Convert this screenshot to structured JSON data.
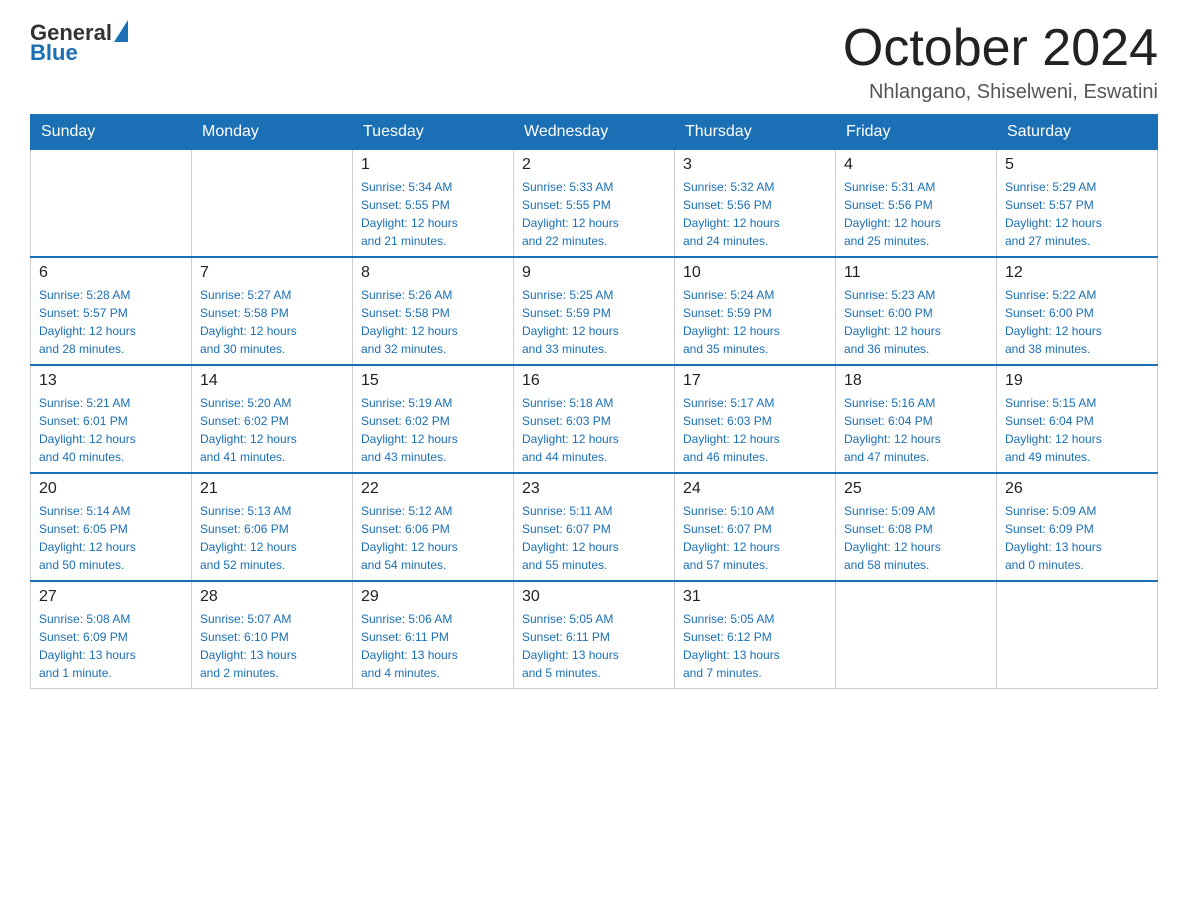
{
  "header": {
    "logo": {
      "text_general": "General",
      "text_blue": "Blue"
    },
    "title": "October 2024",
    "subtitle": "Nhlangano, Shiselweni, Eswatini"
  },
  "days_of_week": [
    "Sunday",
    "Monday",
    "Tuesday",
    "Wednesday",
    "Thursday",
    "Friday",
    "Saturday"
  ],
  "weeks": [
    [
      {
        "day": "",
        "info": ""
      },
      {
        "day": "",
        "info": ""
      },
      {
        "day": "1",
        "info": "Sunrise: 5:34 AM\nSunset: 5:55 PM\nDaylight: 12 hours\nand 21 minutes."
      },
      {
        "day": "2",
        "info": "Sunrise: 5:33 AM\nSunset: 5:55 PM\nDaylight: 12 hours\nand 22 minutes."
      },
      {
        "day": "3",
        "info": "Sunrise: 5:32 AM\nSunset: 5:56 PM\nDaylight: 12 hours\nand 24 minutes."
      },
      {
        "day": "4",
        "info": "Sunrise: 5:31 AM\nSunset: 5:56 PM\nDaylight: 12 hours\nand 25 minutes."
      },
      {
        "day": "5",
        "info": "Sunrise: 5:29 AM\nSunset: 5:57 PM\nDaylight: 12 hours\nand 27 minutes."
      }
    ],
    [
      {
        "day": "6",
        "info": "Sunrise: 5:28 AM\nSunset: 5:57 PM\nDaylight: 12 hours\nand 28 minutes."
      },
      {
        "day": "7",
        "info": "Sunrise: 5:27 AM\nSunset: 5:58 PM\nDaylight: 12 hours\nand 30 minutes."
      },
      {
        "day": "8",
        "info": "Sunrise: 5:26 AM\nSunset: 5:58 PM\nDaylight: 12 hours\nand 32 minutes."
      },
      {
        "day": "9",
        "info": "Sunrise: 5:25 AM\nSunset: 5:59 PM\nDaylight: 12 hours\nand 33 minutes."
      },
      {
        "day": "10",
        "info": "Sunrise: 5:24 AM\nSunset: 5:59 PM\nDaylight: 12 hours\nand 35 minutes."
      },
      {
        "day": "11",
        "info": "Sunrise: 5:23 AM\nSunset: 6:00 PM\nDaylight: 12 hours\nand 36 minutes."
      },
      {
        "day": "12",
        "info": "Sunrise: 5:22 AM\nSunset: 6:00 PM\nDaylight: 12 hours\nand 38 minutes."
      }
    ],
    [
      {
        "day": "13",
        "info": "Sunrise: 5:21 AM\nSunset: 6:01 PM\nDaylight: 12 hours\nand 40 minutes."
      },
      {
        "day": "14",
        "info": "Sunrise: 5:20 AM\nSunset: 6:02 PM\nDaylight: 12 hours\nand 41 minutes."
      },
      {
        "day": "15",
        "info": "Sunrise: 5:19 AM\nSunset: 6:02 PM\nDaylight: 12 hours\nand 43 minutes."
      },
      {
        "day": "16",
        "info": "Sunrise: 5:18 AM\nSunset: 6:03 PM\nDaylight: 12 hours\nand 44 minutes."
      },
      {
        "day": "17",
        "info": "Sunrise: 5:17 AM\nSunset: 6:03 PM\nDaylight: 12 hours\nand 46 minutes."
      },
      {
        "day": "18",
        "info": "Sunrise: 5:16 AM\nSunset: 6:04 PM\nDaylight: 12 hours\nand 47 minutes."
      },
      {
        "day": "19",
        "info": "Sunrise: 5:15 AM\nSunset: 6:04 PM\nDaylight: 12 hours\nand 49 minutes."
      }
    ],
    [
      {
        "day": "20",
        "info": "Sunrise: 5:14 AM\nSunset: 6:05 PM\nDaylight: 12 hours\nand 50 minutes."
      },
      {
        "day": "21",
        "info": "Sunrise: 5:13 AM\nSunset: 6:06 PM\nDaylight: 12 hours\nand 52 minutes."
      },
      {
        "day": "22",
        "info": "Sunrise: 5:12 AM\nSunset: 6:06 PM\nDaylight: 12 hours\nand 54 minutes."
      },
      {
        "day": "23",
        "info": "Sunrise: 5:11 AM\nSunset: 6:07 PM\nDaylight: 12 hours\nand 55 minutes."
      },
      {
        "day": "24",
        "info": "Sunrise: 5:10 AM\nSunset: 6:07 PM\nDaylight: 12 hours\nand 57 minutes."
      },
      {
        "day": "25",
        "info": "Sunrise: 5:09 AM\nSunset: 6:08 PM\nDaylight: 12 hours\nand 58 minutes."
      },
      {
        "day": "26",
        "info": "Sunrise: 5:09 AM\nSunset: 6:09 PM\nDaylight: 13 hours\nand 0 minutes."
      }
    ],
    [
      {
        "day": "27",
        "info": "Sunrise: 5:08 AM\nSunset: 6:09 PM\nDaylight: 13 hours\nand 1 minute."
      },
      {
        "day": "28",
        "info": "Sunrise: 5:07 AM\nSunset: 6:10 PM\nDaylight: 13 hours\nand 2 minutes."
      },
      {
        "day": "29",
        "info": "Sunrise: 5:06 AM\nSunset: 6:11 PM\nDaylight: 13 hours\nand 4 minutes."
      },
      {
        "day": "30",
        "info": "Sunrise: 5:05 AM\nSunset: 6:11 PM\nDaylight: 13 hours\nand 5 minutes."
      },
      {
        "day": "31",
        "info": "Sunrise: 5:05 AM\nSunset: 6:12 PM\nDaylight: 13 hours\nand 7 minutes."
      },
      {
        "day": "",
        "info": ""
      },
      {
        "day": "",
        "info": ""
      }
    ]
  ]
}
